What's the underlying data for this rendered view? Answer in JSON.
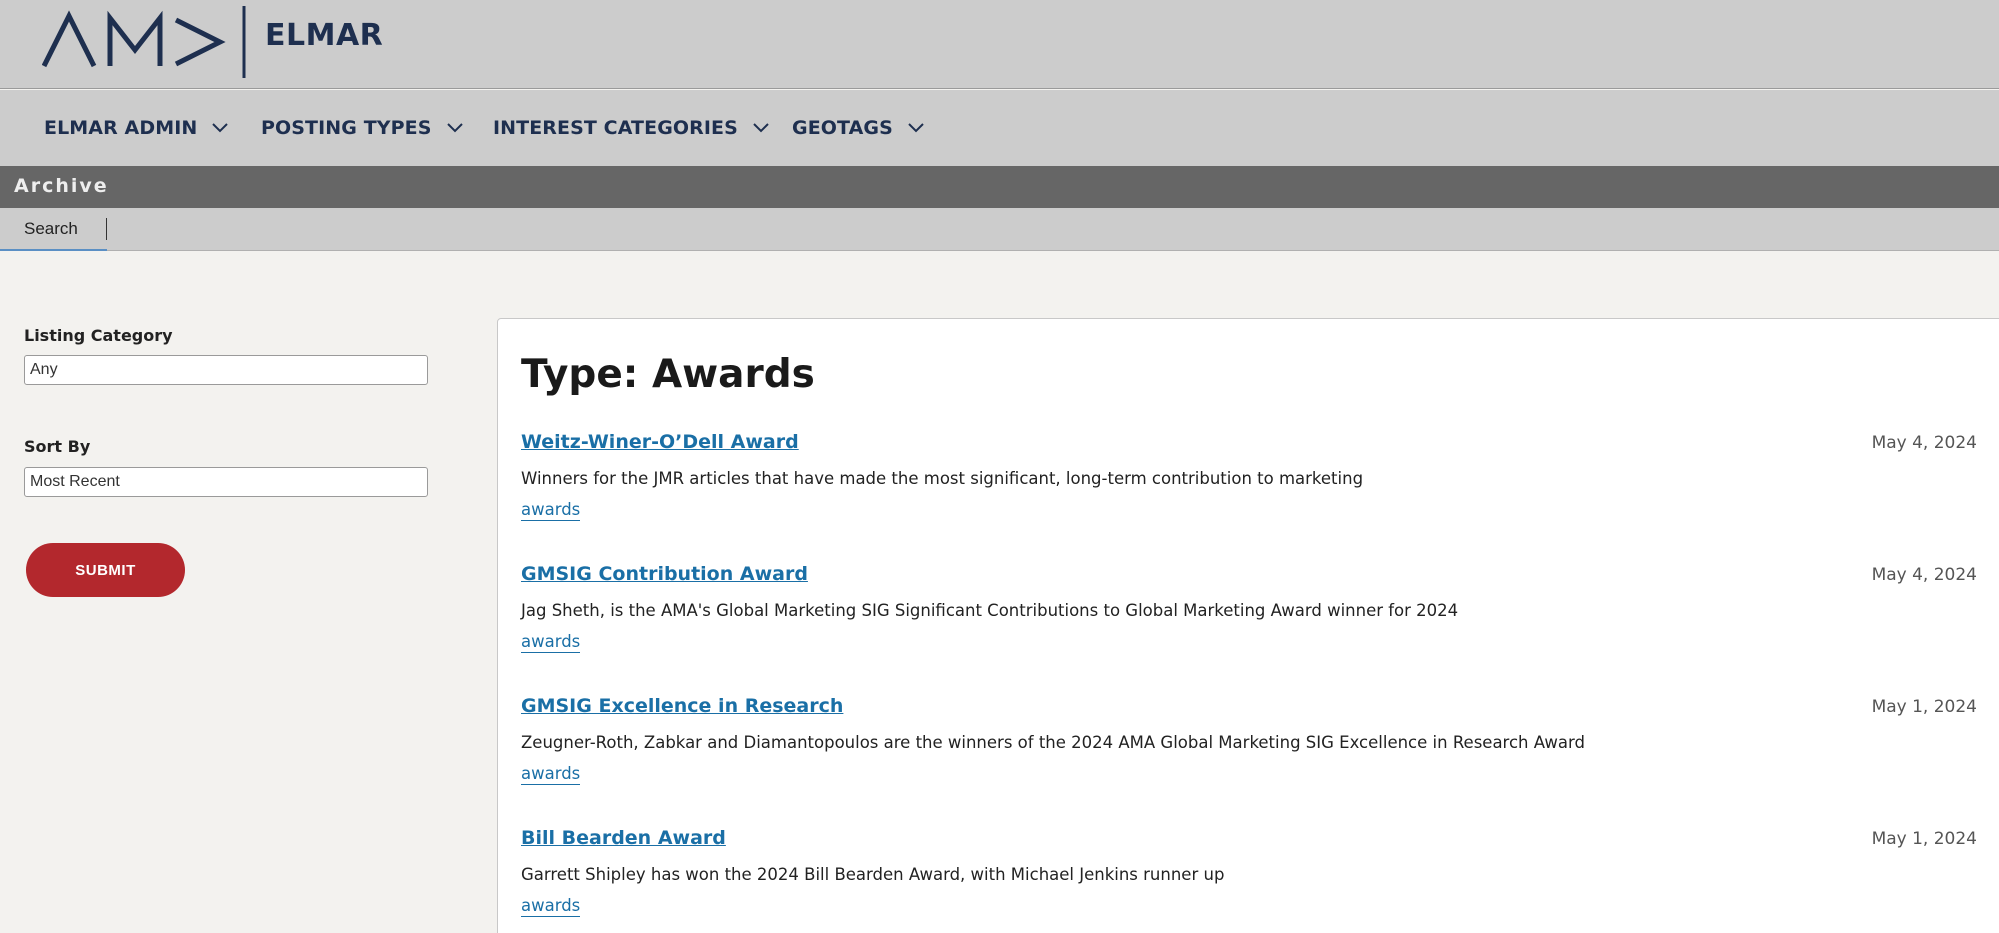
{
  "header": {
    "logo_text": "ELMAR",
    "logo_mark": "AMA"
  },
  "nav": {
    "items": [
      {
        "label": "ELMAR ADMIN"
      },
      {
        "label": "POSTING TYPES"
      },
      {
        "label": "INTEREST CATEGORIES"
      },
      {
        "label": "GEOTAGS"
      }
    ]
  },
  "archive": {
    "title": "Archive",
    "tabs": [
      {
        "label": "Search"
      }
    ]
  },
  "sidebar": {
    "listing_category_label": "Listing Category",
    "listing_category_value": "Any",
    "sort_by_label": "Sort By",
    "sort_by_value": "Most Recent",
    "submit_label": "SUBMIT"
  },
  "main": {
    "title": "Type: Awards",
    "listings": [
      {
        "title": "Weitz-Winer-O’Dell Award",
        "date": "May 4, 2024",
        "description": "Winners for the JMR articles that have made the most significant, long-term contribution to marketing",
        "tag": "awards"
      },
      {
        "title": "GMSIG Contribution Award",
        "date": "May 4, 2024",
        "description": "Jag Sheth, is the AMA's Global Marketing SIG Significant Contributions to Global Marketing Award winner for 2024",
        "tag": "awards"
      },
      {
        "title": "GMSIG Excellence in Research",
        "date": "May 1, 2024",
        "description": "Zeugner-Roth, Zabkar and Diamantopoulos are the winners of the 2024 AMA Global Marketing SIG Excellence in Research Award",
        "tag": "awards"
      },
      {
        "title": "Bill Bearden Award",
        "date": "May 1, 2024",
        "description": "Garrett Shipley has won the 2024 Bill Bearden Award, with Michael Jenkins runner up",
        "tag": "awards"
      }
    ]
  },
  "colors": {
    "brand_navy": "#1e2f4f",
    "link_blue": "#1a6fa6",
    "submit_red": "#b3282d",
    "archive_bar": "#666666"
  }
}
